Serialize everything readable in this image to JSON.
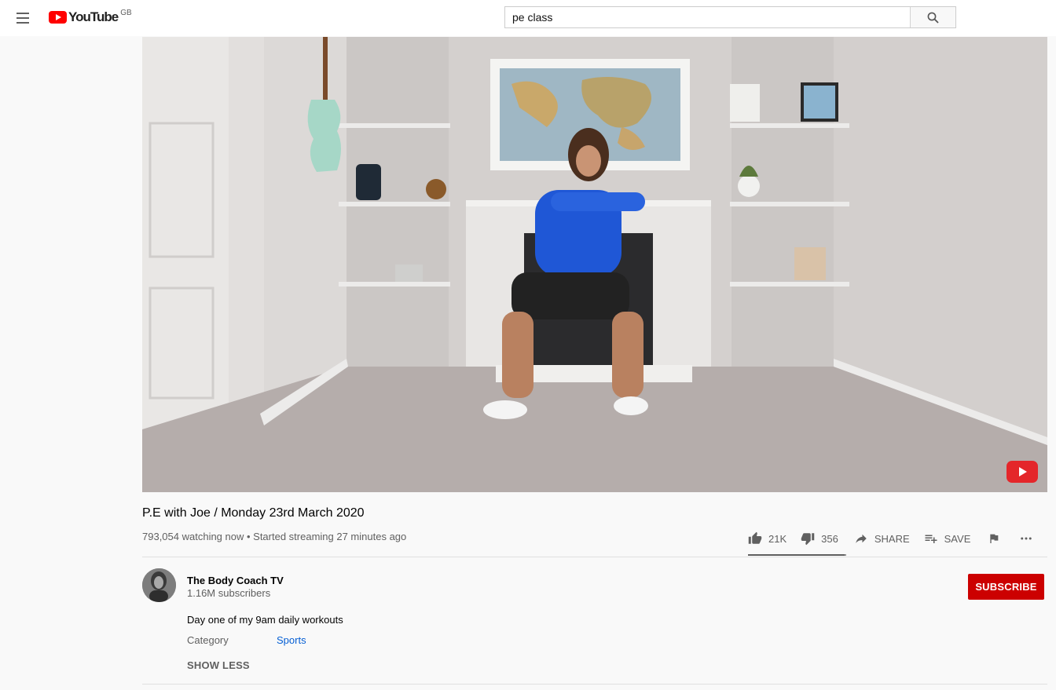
{
  "masthead": {
    "logo_text": "YouTube",
    "region": "GB",
    "search": {
      "value": "pe class",
      "placeholder": "Search"
    }
  },
  "video": {
    "title": "P.E with Joe / Monday 23rd March 2020",
    "meta": "793,054 watching now • Started streaming 27 minutes ago",
    "like_fraction": 0.98
  },
  "actions": {
    "likes": "21K",
    "dislikes": "356",
    "share": "SHARE",
    "save": "SAVE"
  },
  "channel": {
    "name": "The Body Coach TV",
    "subscribers": "1.16M subscribers",
    "subscribe_label": "SUBSCRIBE"
  },
  "description": {
    "text": "Day one of my 9am daily workouts",
    "category_label": "Category",
    "category_value": "Sports",
    "show_less": "SHOW LESS"
  },
  "colors": {
    "brand_red": "#ff0000",
    "subscribe_red": "#cc0000",
    "link_blue": "#065fd4"
  }
}
